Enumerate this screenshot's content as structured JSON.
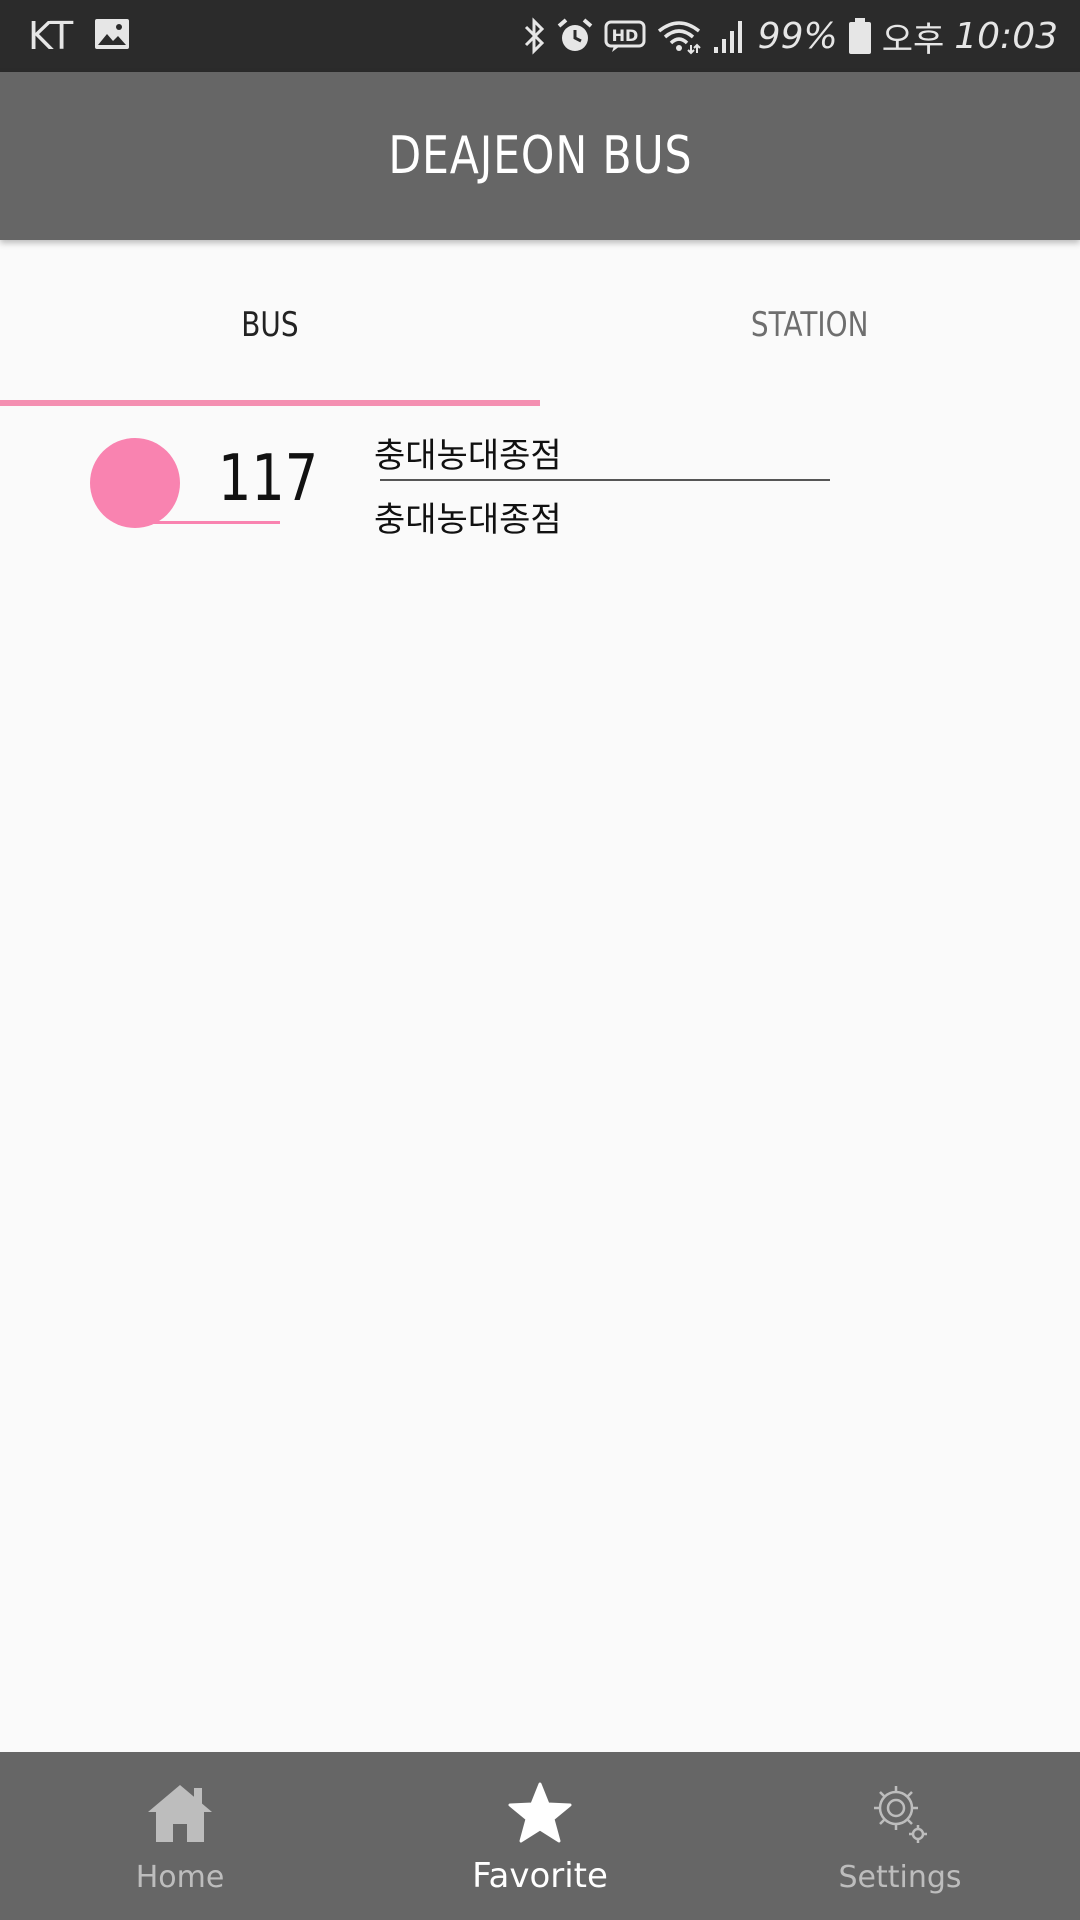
{
  "status_bar": {
    "carrier": "KT",
    "battery": "99%",
    "ampm": "오후",
    "time": "10:03",
    "icons": [
      "gallery-icon",
      "bluetooth-icon",
      "alarm-icon",
      "hd-icon",
      "wifi-icon",
      "signal-icon",
      "battery-icon"
    ]
  },
  "app_bar": {
    "title": "DEAJEON BUS"
  },
  "tabs": [
    {
      "label": "BUS",
      "selected": true
    },
    {
      "label": "STATION",
      "selected": false
    }
  ],
  "favorites": [
    {
      "bus_number": "117",
      "start_stop": "충대농대종점",
      "end_stop": "충대농대종점",
      "color": "#f983b0"
    }
  ],
  "bottom_nav": [
    {
      "label": "Home",
      "icon": "home-icon",
      "active": false
    },
    {
      "label": "Favorite",
      "icon": "star-icon",
      "active": true
    },
    {
      "label": "Settings",
      "icon": "settings-icon",
      "active": false
    }
  ],
  "colors": {
    "app_bar": "#666666",
    "accent": "#f48fb1",
    "status_bar": "#2b2b2b",
    "background": "#fafafa"
  }
}
